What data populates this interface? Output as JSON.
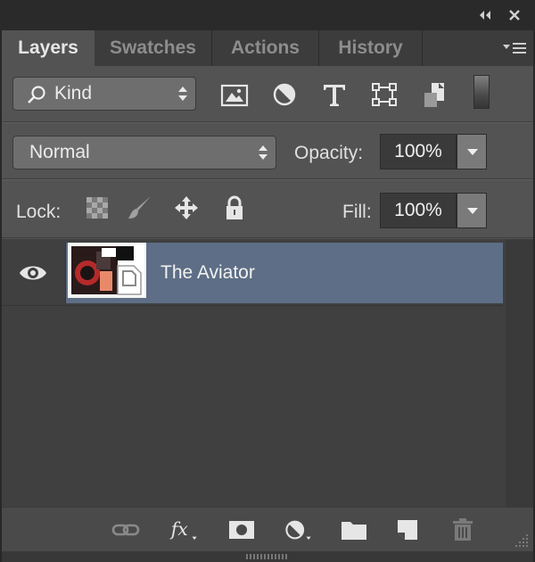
{
  "tabs": [
    {
      "label": "Layers",
      "active": true
    },
    {
      "label": "Swatches",
      "active": false
    },
    {
      "label": "Actions",
      "active": false
    },
    {
      "label": "History",
      "active": false
    }
  ],
  "filter": {
    "kind_label": "Kind"
  },
  "blend": {
    "mode": "Normal",
    "opacity_label": "Opacity:",
    "opacity_value": "100%"
  },
  "lock": {
    "label": "Lock:",
    "fill_label": "Fill:",
    "fill_value": "100%"
  },
  "layers": [
    {
      "name": "The Aviator",
      "visible": true,
      "selected": true
    }
  ],
  "colors": {
    "panel_bg": "#535353",
    "selected_row": "#5d6e86",
    "list_bg": "#404040"
  },
  "icons": {
    "filter": [
      "image-filter-icon",
      "adjustment-filter-icon",
      "type-filter-icon",
      "shape-filter-icon",
      "smart-object-filter-icon"
    ],
    "lock": [
      "lock-transparent-pixels-icon",
      "lock-image-pixels-icon",
      "lock-position-icon",
      "lock-all-icon"
    ],
    "footer": [
      "link-layers-icon",
      "fx-icon",
      "add-mask-icon",
      "new-adjustment-layer-icon",
      "new-group-icon",
      "new-layer-icon",
      "delete-layer-icon"
    ]
  }
}
